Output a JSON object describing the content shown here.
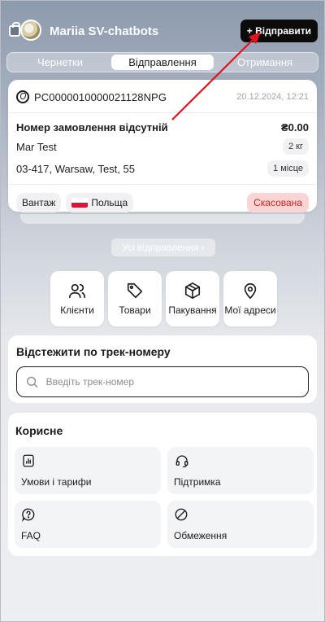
{
  "header": {
    "channel_name": "Mariia SV-chatbots",
    "send_button": "+ Відправити"
  },
  "tabs": [
    {
      "label": "Чернетки",
      "active": false
    },
    {
      "label": "Відправлення",
      "active": true
    },
    {
      "label": "Отримання",
      "active": false
    }
  ],
  "shipment": {
    "order_id": "PC0000010000021128NPG",
    "date": "20.12.2024, 12:21",
    "order_number_text": "Номер замовлення відсутній",
    "amount": "₴0.00",
    "recipient": "Mar Test",
    "weight": "2 кг",
    "address": "03-417, Warsaw, Test, 55",
    "places": "1 місце",
    "type": "Вантаж",
    "country": "Польща",
    "status": "Скасована"
  },
  "all_shipments_button": "Усі відправлення ›",
  "quick_actions": [
    {
      "label": "Клієнти",
      "icon": "users-icon"
    },
    {
      "label": "Товари",
      "icon": "tag-icon"
    },
    {
      "label": "Пакування",
      "icon": "box-icon"
    },
    {
      "label": "Мої адреси",
      "icon": "location-pin-icon"
    }
  ],
  "tracking": {
    "title": "Відстежити по трек-номеру",
    "placeholder": "Введіть трек-номер"
  },
  "useful": {
    "title": "Корисне",
    "items": [
      {
        "label": "Умови і тарифи",
        "icon": "chart-document-icon"
      },
      {
        "label": "Підтримка",
        "icon": "headset-icon"
      },
      {
        "label": "FAQ",
        "icon": "question-bubble-icon"
      },
      {
        "label": "Обмеження",
        "icon": "prohibited-icon"
      }
    ]
  },
  "colors": {
    "accent_black": "#0b0b0b",
    "status_cancelled_bg": "#fbd4d4",
    "status_cancelled_text": "#cc2222",
    "annotation_arrow": "#e0141e"
  }
}
